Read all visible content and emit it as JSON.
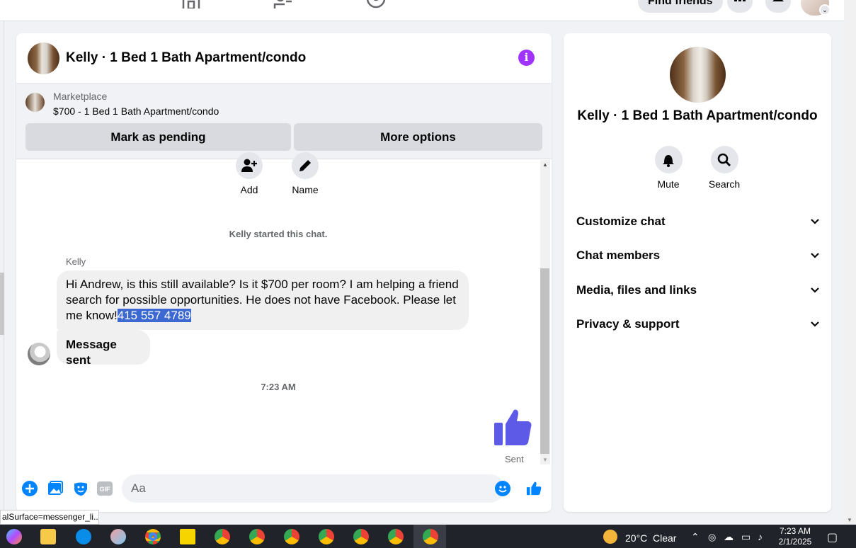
{
  "topbar": {
    "find_friends": "Find friends"
  },
  "chat": {
    "title": "Kelly · 1 Bed 1 Bath Apartment/condo",
    "marketplace_label": "Marketplace",
    "listing": "$700 - 1 Bed 1 Bath Apartment/condo",
    "mark_pending": "Mark as pending",
    "more_options": "More options",
    "actions": [
      {
        "label": "Add",
        "icon": "add-person-icon"
      },
      {
        "label": "Name",
        "icon": "pencil-icon"
      }
    ],
    "started_text": "Kelly started this chat.",
    "sender_name": "Kelly",
    "message_1_text": "Hi Andrew, is this still available? Is it $700 per room? I am helping a friend search for possible opportunities. He does not have Facebook. Please let me know!",
    "message_1_highlight": "415 557 4789",
    "message_2": "Message sent",
    "timestamp": "7:23 AM",
    "sent_label": "Sent",
    "composer_placeholder": "Aa",
    "accent_color": "#0084ff",
    "like_color": "#5d5ae8"
  },
  "info_panel": {
    "title": "Kelly · 1 Bed 1 Bath Apartment/condo",
    "mute": "Mute",
    "search": "Search",
    "sections": [
      "Customize chat",
      "Chat members",
      "Media, files and links",
      "Privacy & support"
    ]
  },
  "status_tooltip": "alSurface=messenger_li...",
  "taskbar": {
    "weather_temp": "20°C",
    "weather_desc": "Clear",
    "time": "7:23 AM",
    "date": "2/1/2025"
  }
}
